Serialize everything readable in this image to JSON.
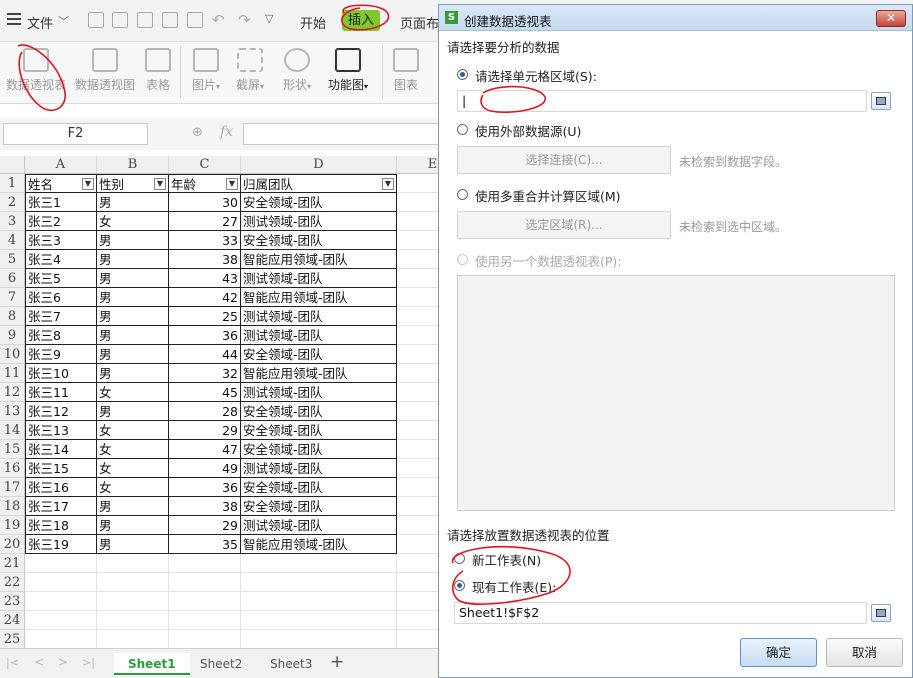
{
  "menubar": {
    "menu_label": "文件",
    "tabs": [
      "开始",
      "插入",
      "页面布"
    ],
    "active_tab": "插入"
  },
  "ribbon": {
    "buttons": [
      "数据透视表",
      "数据透视图",
      "表格",
      "图片",
      "截屏",
      "形状",
      "功能图",
      "图表"
    ]
  },
  "formula_bar": {
    "name_box": "F2",
    "fx": "fx"
  },
  "sheet": {
    "columns": [
      "A",
      "B",
      "C",
      "D",
      "E"
    ],
    "header": [
      "姓名",
      "性别",
      "年龄",
      "归属团队"
    ],
    "rows": [
      [
        "张三1",
        "男",
        "30",
        "安全领域-团队"
      ],
      [
        "张三2",
        "女",
        "27",
        "测试领域-团队"
      ],
      [
        "张三3",
        "男",
        "33",
        "安全领域-团队"
      ],
      [
        "张三4",
        "男",
        "38",
        "智能应用领域-团队"
      ],
      [
        "张三5",
        "男",
        "43",
        "测试领域-团队"
      ],
      [
        "张三6",
        "男",
        "42",
        "智能应用领域-团队"
      ],
      [
        "张三7",
        "男",
        "25",
        "测试领域-团队"
      ],
      [
        "张三8",
        "男",
        "36",
        "测试领域-团队"
      ],
      [
        "张三9",
        "男",
        "44",
        "安全领域-团队"
      ],
      [
        "张三10",
        "男",
        "32",
        "智能应用领域-团队"
      ],
      [
        "张三11",
        "女",
        "45",
        "测试领域-团队"
      ],
      [
        "张三12",
        "男",
        "28",
        "安全领域-团队"
      ],
      [
        "张三13",
        "女",
        "29",
        "安全领域-团队"
      ],
      [
        "张三14",
        "女",
        "47",
        "安全领域-团队"
      ],
      [
        "张三15",
        "女",
        "49",
        "测试领域-团队"
      ],
      [
        "张三16",
        "女",
        "36",
        "安全领域-团队"
      ],
      [
        "张三17",
        "男",
        "38",
        "安全领域-团队"
      ],
      [
        "张三18",
        "男",
        "29",
        "测试领域-团队"
      ],
      [
        "张三19",
        "男",
        "35",
        "智能应用领域-团队"
      ]
    ],
    "row_numbers": [
      "1",
      "2",
      "3",
      "4",
      "5",
      "6",
      "7",
      "8",
      "9",
      "10",
      "11",
      "12",
      "13",
      "14",
      "15",
      "16",
      "17",
      "18",
      "19",
      "20",
      "21",
      "22",
      "23",
      "24",
      "25"
    ],
    "tabs": [
      "Sheet1",
      "Sheet2",
      "Sheet3"
    ],
    "active_tab": "Sheet1",
    "add_tab": "+"
  },
  "dialog": {
    "title": "创建数据透视表",
    "close": "✕",
    "section1": "请选择要分析的数据",
    "opt_range": "请选择单元格区域(S):",
    "range_value": "|",
    "opt_external": "使用外部数据源(U)",
    "select_conn": "选择连接(C)...",
    "external_note": "未检索到数据字段。",
    "opt_multi": "使用多重合并计算区域(M)",
    "select_region": "选定区域(R)...",
    "multi_note": "未检索到选中区域。",
    "opt_another": "使用另一个数据透视表(P):",
    "section2": "请选择放置数据透视表的位置",
    "opt_new": "新工作表(N)",
    "opt_existing": "现有工作表(E):",
    "location_value": "Sheet1!$F$2",
    "ok": "确定",
    "cancel": "取消"
  }
}
